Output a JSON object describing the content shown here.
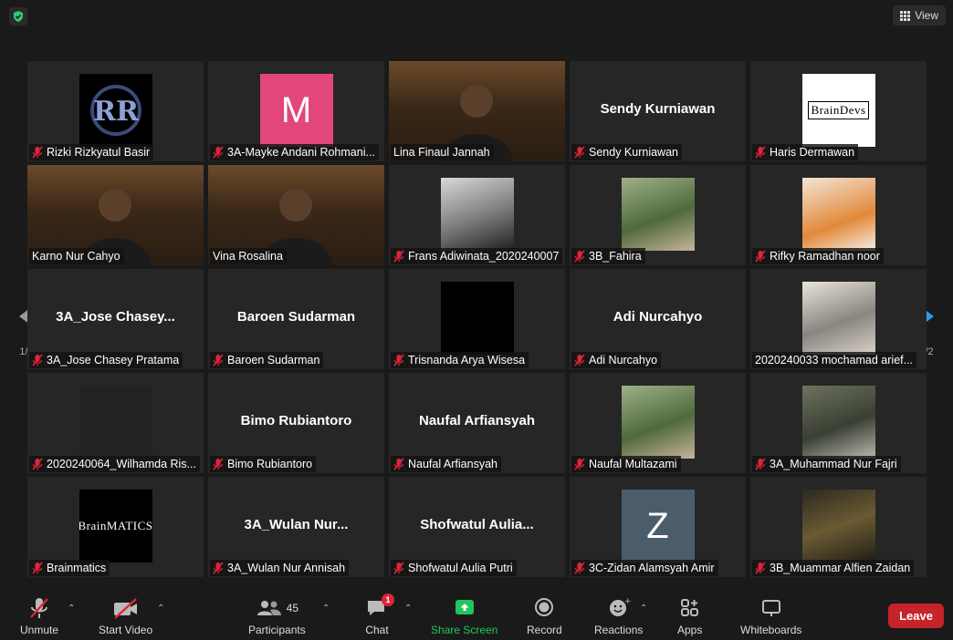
{
  "header": {
    "view_label": "View",
    "shield_color": "#2ecc71"
  },
  "pager": {
    "left_page": "1/2",
    "right_page": "1/2",
    "arrow_color": "#2e9bf0"
  },
  "participants": [
    {
      "name": "Rizki Rizkyatul Basir",
      "display": "avatar",
      "avatar_icon": "rr-logo-icon",
      "muted": true
    },
    {
      "name": "3A-Mayke Andani Rohmani...",
      "display": "avatar",
      "avatar_letter": "M",
      "avatar_color": "#e2477a",
      "muted": true
    },
    {
      "name": "Lina Finaul Jannah",
      "display": "video",
      "muted": false
    },
    {
      "name": "Sendy Kurniawan",
      "display": "name",
      "big_name": "Sendy Kurniawan",
      "muted": true
    },
    {
      "name": "Haris Dermawan",
      "display": "avatar",
      "avatar_text": "BrainDevs",
      "avatar_color": "#ffffff",
      "muted": true
    },
    {
      "name": "Karno Nur Cahyo",
      "display": "video",
      "active": true,
      "muted": false
    },
    {
      "name": "Vina Rosalina",
      "display": "video",
      "muted": false
    },
    {
      "name": "Frans Adiwinata_2020240007",
      "display": "avatar",
      "avatar_icon": "masked-person-photo-icon",
      "muted": true
    },
    {
      "name": "3B_Fahira",
      "display": "avatar",
      "avatar_icon": "outdoor-photo-icon",
      "muted": true
    },
    {
      "name": "Rifky Ramadhan noor",
      "display": "avatar",
      "avatar_icon": "anime-avatar-icon",
      "muted": true
    },
    {
      "name": "3A_Jose Chasey Pratama",
      "display": "name",
      "big_name": "3A_Jose  Chasey...",
      "muted": true
    },
    {
      "name": "Baroen Sudarman",
      "display": "name",
      "big_name": "Baroen Sudarman",
      "muted": true
    },
    {
      "name": "Trisnanda Arya Wisesa",
      "display": "avatar",
      "avatar_color": "#000000",
      "muted": true
    },
    {
      "name": "Adi Nurcahyo",
      "display": "name",
      "big_name": "Adi Nurcahyo",
      "muted": true
    },
    {
      "name": "2020240033 mochamad arief...",
      "display": "avatar",
      "avatar_icon": "wolf-drawing-icon",
      "muted": false
    },
    {
      "name": "2020240064_Wilhamda Ris...",
      "display": "avatar",
      "avatar_color": "#222222",
      "muted": true
    },
    {
      "name": "Bimo Rubiantoro",
      "display": "name",
      "big_name": "Bimo Rubiantoro",
      "muted": true
    },
    {
      "name": "Naufal Arfiansyah",
      "display": "name",
      "big_name": "Naufal Arfiansyah",
      "muted": true
    },
    {
      "name": "Naufal Multazami",
      "display": "avatar",
      "avatar_icon": "outdoor-photo-icon",
      "muted": true
    },
    {
      "name": "3A_Muhammad Nur Fajri",
      "display": "avatar",
      "avatar_icon": "shoes-photo-icon",
      "muted": true
    },
    {
      "name": "Brainmatics",
      "display": "avatar",
      "avatar_text": "BrainMATICS",
      "avatar_color": "#000000",
      "muted": true
    },
    {
      "name": "3A_Wulan Nur Annisah",
      "display": "name",
      "big_name": "3A_Wulan  Nur...",
      "muted": true
    },
    {
      "name": "Shofwatul Aulia Putri",
      "display": "name",
      "big_name": "Shofwatul  Aulia...",
      "muted": true
    },
    {
      "name": "3C-Zidan Alamsyah Amir",
      "display": "avatar",
      "avatar_letter": "Z",
      "avatar_color": "#4b5d6b",
      "muted": true
    },
    {
      "name": "3B_Muammar Alfien Zaidan",
      "display": "avatar",
      "avatar_icon": "forest-photo-icon",
      "muted": true
    }
  ],
  "toolbar": {
    "unmute_label": "Unmute",
    "start_video_label": "Start Video",
    "participants_label": "Participants",
    "participants_count": "45",
    "chat_label": "Chat",
    "chat_badge": "1",
    "share_screen_label": "Share Screen",
    "share_color": "#22c55e",
    "record_label": "Record",
    "reactions_label": "Reactions",
    "apps_label": "Apps",
    "whiteboards_label": "Whiteboards",
    "leave_label": "Leave",
    "leave_color": "#c6232a"
  }
}
